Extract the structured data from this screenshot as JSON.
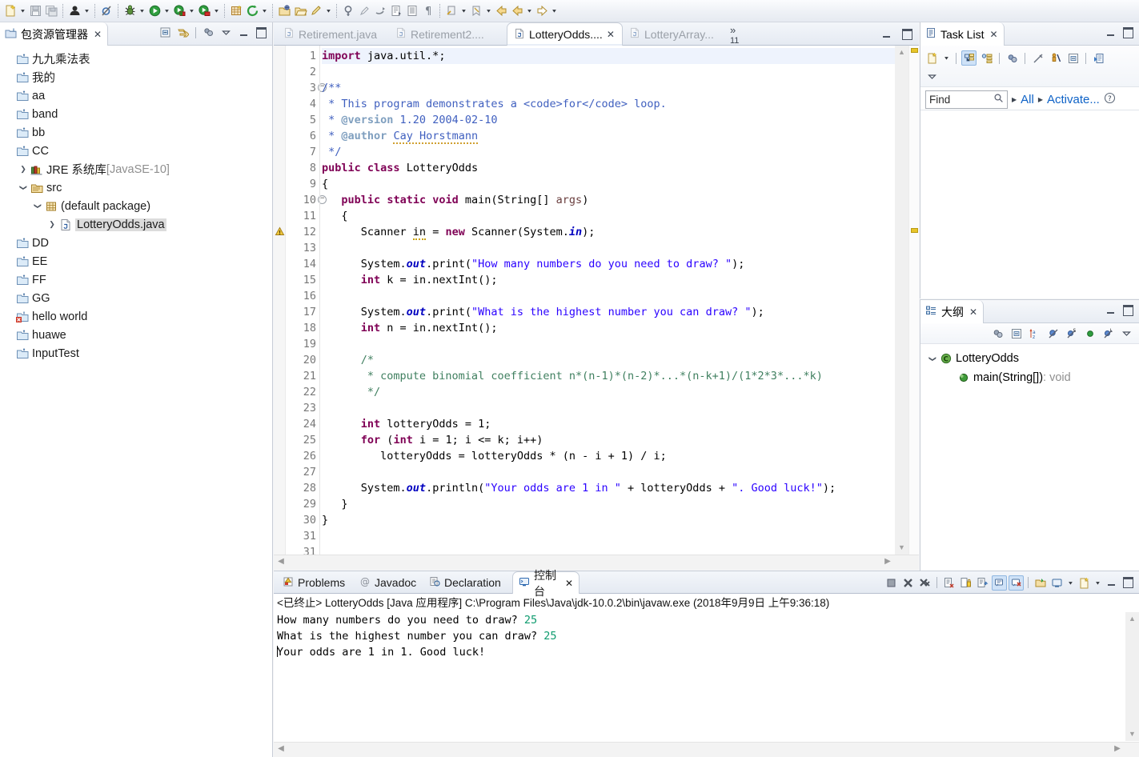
{
  "toolbar": {
    "items": [
      {
        "icon": "new-wizard-icon",
        "arrow": true
      },
      {
        "icon": "save-icon",
        "arrow": false
      },
      {
        "icon": "save-all-icon",
        "arrow": false
      },
      {
        "sep": true
      },
      {
        "icon": "person-debug-icon",
        "arrow": true
      },
      {
        "sep": true
      },
      {
        "icon": "skip-breakpoints-icon",
        "arrow": false
      },
      {
        "sep": true
      },
      {
        "icon": "debug-bug-icon",
        "arrow": true
      },
      {
        "icon": "run-icon",
        "arrow": true
      },
      {
        "icon": "coverage-icon",
        "arrow": true
      },
      {
        "icon": "run-last-tool-icon",
        "arrow": true
      },
      {
        "sep": true
      },
      {
        "icon": "new-java-project-icon",
        "arrow": false
      },
      {
        "icon": "external-tools-icon",
        "arrow": true
      },
      {
        "sep": true
      },
      {
        "icon": "new-package-icon",
        "arrow": false
      },
      {
        "icon": "open-type-icon",
        "arrow": false
      },
      {
        "icon": "quick-fix-icon",
        "arrow": true
      },
      {
        "sep": true
      },
      {
        "icon": "search-icon",
        "arrow": false
      },
      {
        "icon": "pencil-icon",
        "arrow": false
      },
      {
        "icon": "link-editor-icon",
        "arrow": false
      },
      {
        "icon": "next-annotation-icon",
        "arrow": false
      },
      {
        "icon": "toggle-block-selection-icon",
        "arrow": false
      },
      {
        "icon": "show-whitespace-icon",
        "arrow": false
      },
      {
        "sep": true
      },
      {
        "icon": "previous-edit-icon",
        "arrow": true
      },
      {
        "icon": "last-edit-location-icon",
        "arrow": true
      },
      {
        "icon": "back-icon",
        "arrow": false
      },
      {
        "icon": "back-history-icon",
        "arrow": true
      },
      {
        "icon": "forward-icon",
        "arrow": true
      }
    ]
  },
  "explorer": {
    "title": "包资源管理器",
    "close_label": "✕",
    "tools": [
      {
        "name": "collapse-all-icon"
      },
      {
        "name": "link-with-editor-icon"
      },
      {
        "name": "view-menu-filters-icon"
      },
      {
        "name": "view-menu-icon"
      },
      {
        "name": "minimize-icon"
      },
      {
        "name": "maximize-icon"
      }
    ],
    "tree": [
      {
        "label": "九九乘法表",
        "indent": 0,
        "twist": "",
        "icon": "java-project-icon",
        "selected": false
      },
      {
        "label": "我的",
        "indent": 0,
        "twist": "",
        "icon": "java-project-icon",
        "selected": false
      },
      {
        "label": "aa",
        "indent": 0,
        "twist": "",
        "icon": "java-project-icon",
        "selected": false
      },
      {
        "label": "band",
        "indent": 0,
        "twist": "",
        "icon": "java-project-icon",
        "selected": false
      },
      {
        "label": "bb",
        "indent": 0,
        "twist": "",
        "icon": "java-project-icon",
        "selected": false
      },
      {
        "label": "CC",
        "indent": 0,
        "twist": "",
        "icon": "java-project-icon",
        "selected": false
      },
      {
        "label": "JRE 系统库",
        "suffix": " [JavaSE-10]",
        "indent": 1,
        "twist": "collapsed",
        "icon": "jre-library-icon",
        "selected": false
      },
      {
        "label": "src",
        "indent": 1,
        "twist": "expanded",
        "icon": "source-folder-icon",
        "selected": false
      },
      {
        "label": "(default package)",
        "indent": 2,
        "twist": "expanded",
        "icon": "package-icon",
        "selected": false
      },
      {
        "label": "LotteryOdds.java",
        "indent": 3,
        "twist": "collapsed",
        "icon": "java-file-icon",
        "selected": true
      },
      {
        "label": "DD",
        "indent": 0,
        "twist": "",
        "icon": "java-project-icon",
        "selected": false
      },
      {
        "label": "EE",
        "indent": 0,
        "twist": "",
        "icon": "java-project-icon",
        "selected": false
      },
      {
        "label": "FF",
        "indent": 0,
        "twist": "",
        "icon": "java-project-icon",
        "selected": false
      },
      {
        "label": "GG",
        "indent": 0,
        "twist": "",
        "icon": "java-project-icon",
        "selected": false
      },
      {
        "label": "hello world",
        "indent": 0,
        "twist": "",
        "icon": "java-project-error-icon",
        "selected": false
      },
      {
        "label": "huawe",
        "indent": 0,
        "twist": "",
        "icon": "java-project-icon",
        "selected": false
      },
      {
        "label": "InputTest",
        "indent": 0,
        "twist": "",
        "icon": "java-project-icon",
        "selected": false
      }
    ]
  },
  "editor": {
    "tabs": [
      {
        "label": "Retirement.java",
        "active": false,
        "closable": false
      },
      {
        "label": "Retirement2....",
        "active": false,
        "closable": false
      },
      {
        "label": "LotteryOdds....",
        "active": true,
        "closable": true
      },
      {
        "label": "LotteryArray...",
        "active": false,
        "closable": false
      }
    ],
    "overflow_chevron": "»",
    "overflow_count": "11",
    "close_label": "✕",
    "file_name": "LotteryOdds.java",
    "first_line": 1,
    "last_line": 31,
    "code_lines": [
      "import java.util.*;",
      "",
      "/**",
      " * This program demonstrates a <code>for</code> loop.",
      " * @version 1.20 2004-02-10",
      " * @author Cay Horstmann",
      " */",
      "public class LotteryOdds",
      "{",
      "   public static void main(String[] args)",
      "   {",
      "      Scanner in = new Scanner(System.in);",
      "",
      "      System.out.print(\"How many numbers do you need to draw? \");",
      "      int k = in.nextInt();",
      "",
      "      System.out.print(\"What is the highest number you can draw? \");",
      "      int n = in.nextInt();",
      "",
      "      /*",
      "       * compute binomial coefficient n*(n-1)*(n-2)*...*(n-k+1)/(1*2*3*...*k)",
      "       */",
      "",
      "      int lotteryOdds = 1;",
      "      for (int i = 1; i <= k; i++)",
      "         lotteryOdds = lotteryOdds * (n - i + 1) / i;",
      "",
      "      System.out.println(\"Your odds are 1 in \" + lotteryOdds + \". Good luck!\");",
      "   }",
      "}",
      ""
    ],
    "fold_lines": [
      3,
      10
    ],
    "warning_lines": [
      12
    ],
    "highlight_line": 1
  },
  "tasklist": {
    "title": "Task List",
    "close_label": "✕",
    "tools_row1": [
      {
        "name": "new-task-icon"
      },
      {
        "name": "new-task-dropdown-icon"
      },
      {
        "name": "categorized-presentation-icon",
        "active": true
      },
      {
        "name": "scheduled-presentation-icon"
      },
      {
        "name": "synchronize-changed-icon"
      },
      {
        "name": "focus-on-workweek-icon"
      },
      {
        "name": "collapse-all-icon"
      },
      {
        "name": "restore-task-list-icon"
      }
    ],
    "tools_row2": [
      {
        "name": "view-menu-icon"
      }
    ],
    "find_placeholder": "Find",
    "find_value": "",
    "search_icon": "search-icon",
    "filter_all": "All",
    "filter_activate": "Activate...",
    "help_icon": "help-icon",
    "min_icon": "minimize-icon",
    "max_icon": "maximize-icon"
  },
  "outline": {
    "title": "大纲",
    "close_label": "✕",
    "tools": [
      {
        "name": "focus-on-active-task-icon"
      },
      {
        "name": "collapse-all-icon"
      },
      {
        "name": "sort-icon"
      },
      {
        "name": "hide-fields-icon"
      },
      {
        "name": "hide-static-icon"
      },
      {
        "name": "hide-non-public-icon"
      },
      {
        "name": "hide-local-types-icon"
      },
      {
        "name": "view-menu-icon"
      }
    ],
    "min_icon": "minimize-icon",
    "max_icon": "maximize-icon",
    "tree": [
      {
        "label": "LotteryOdds",
        "indent": 0,
        "twist": "expanded",
        "icon": "class-public-icon",
        "suffix": ""
      },
      {
        "label": "main(String[])",
        "indent": 1,
        "twist": "",
        "icon": "method-public-static-icon",
        "suffix": " : void"
      }
    ]
  },
  "console": {
    "tabs": [
      {
        "label": "Problems",
        "icon": "problems-icon",
        "active": false,
        "closable": false
      },
      {
        "label": "Javadoc",
        "icon": "javadoc-icon",
        "active": false,
        "closable": false
      },
      {
        "label": "Declaration",
        "icon": "declaration-icon",
        "active": false,
        "closable": false
      },
      {
        "label": "控制台",
        "icon": "console-icon",
        "active": true,
        "closable": true
      }
    ],
    "close_label": "✕",
    "tools": [
      {
        "name": "terminate-icon"
      },
      {
        "name": "remove-launch-icon"
      },
      {
        "name": "remove-all-terminated-icon"
      },
      {
        "name": "clear-console-icon"
      },
      {
        "name": "scroll-lock-icon"
      },
      {
        "name": "word-wrap-icon"
      },
      {
        "name": "show-console-on-output-icon",
        "active": true
      },
      {
        "name": "show-console-on-error-icon",
        "active": true
      },
      {
        "name": "pin-console-icon"
      },
      {
        "name": "display-selected-console-icon"
      },
      {
        "name": "display-selected-console-dropdown-icon"
      },
      {
        "name": "open-console-icon"
      },
      {
        "name": "open-console-dropdown-icon"
      },
      {
        "name": "minimize-icon"
      },
      {
        "name": "maximize-icon"
      }
    ],
    "header": "<已终止> LotteryOdds [Java 应用程序] C:\\Program Files\\Java\\jdk-10.0.2\\bin\\javaw.exe (2018年9月9日 上午9:36:18)",
    "output": [
      {
        "prompt": "How many numbers do you need to draw? ",
        "value": "25"
      },
      {
        "prompt": "What is the highest number you can draw? ",
        "value": "25"
      },
      {
        "prompt": "Your odds are 1 in 1. Good luck!",
        "value": ""
      }
    ]
  },
  "colors": {
    "keyword": "#7f0055",
    "string": "#2a00ff",
    "comment": "#3f7f5f",
    "javadoc": "#3f5fbf",
    "field": "#0000c0",
    "link": "#0e62c7",
    "selection": "#dcdcdc",
    "console_input": "#0e9b6e"
  }
}
